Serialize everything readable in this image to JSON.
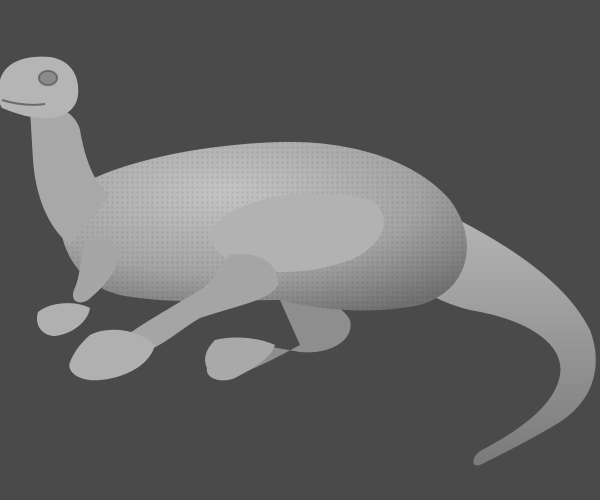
{
  "scene": {
    "subject": "dinosaur-sculpture",
    "colors": {
      "background": "#4a4a4a",
      "clay_light": "#bdbdbd",
      "clay_mid": "#9a9a9a",
      "clay_dark": "#6a6a6a"
    }
  }
}
